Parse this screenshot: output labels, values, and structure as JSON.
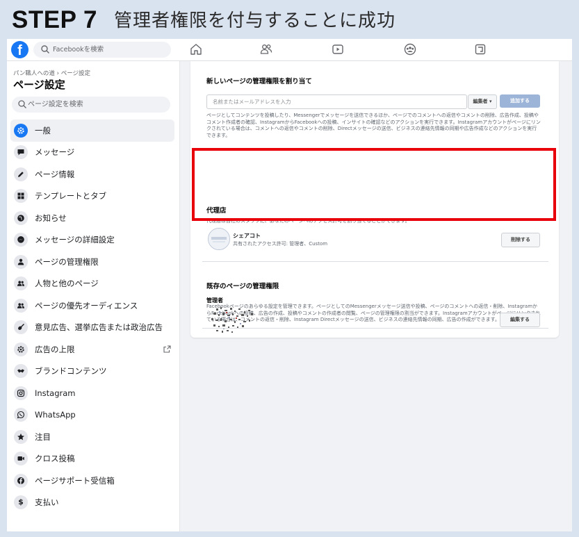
{
  "heading": {
    "step": "STEP 7",
    "description": "管理者権限を付与することに成功"
  },
  "topbar": {
    "logo_letter": "f",
    "search_placeholder": "Facebookを検索",
    "nav_icons": [
      "home-icon",
      "friends-icon",
      "watch-icon",
      "groups-icon",
      "gaming-icon"
    ]
  },
  "sidebar": {
    "breadcrumb": "パン職人への道 › ページ設定",
    "title": "ページ設定",
    "search_placeholder": "ページ設定を検索",
    "items": [
      {
        "label": "一般",
        "icon": "gear-icon"
      },
      {
        "label": "メッセージ",
        "icon": "message-icon"
      },
      {
        "label": "ページ情報",
        "icon": "pencil-icon"
      },
      {
        "label": "テンプレートとタブ",
        "icon": "grid-icon"
      },
      {
        "label": "お知らせ",
        "icon": "globe-icon"
      },
      {
        "label": "メッセージの詳細設定",
        "icon": "messenger-icon"
      },
      {
        "label": "ページの管理権限",
        "icon": "person-icon"
      },
      {
        "label": "人物と他のページ",
        "icon": "people-icon"
      },
      {
        "label": "ページの優先オーディエンス",
        "icon": "people-icon"
      },
      {
        "label": "意見広告、選挙広告または政治広告",
        "icon": "guitar-icon"
      },
      {
        "label": "広告の上限",
        "icon": "gear-icon"
      },
      {
        "label": "ブランドコンテンツ",
        "icon": "handshake-icon"
      },
      {
        "label": "Instagram",
        "icon": "instagram-icon"
      },
      {
        "label": "WhatsApp",
        "icon": "whatsapp-icon"
      },
      {
        "label": "注目",
        "icon": "star-icon"
      },
      {
        "label": "クロス投稿",
        "icon": "video-icon"
      },
      {
        "label": "ページサポート受信箱",
        "icon": "facebook-icon"
      },
      {
        "label": "支払い",
        "icon": "dollar-icon"
      }
    ]
  },
  "assign": {
    "title": "新しいページの管理権限を割り当て",
    "input_placeholder": "名前またはメールアドレスを入力",
    "role_select": "編集者 ▾",
    "add_button": "追加する",
    "description": "ページとしてコンテンツを投稿したり、Messengerでメッセージを送信できるほか、ページでのコメントへの返信やコメントの削除、広告作成、投稿やコメント作成者の確認、InstagramからFacebookへの投稿、インサイトの確認などのアクションを実行できます。Instagramアカウントがページにリンクされている場合は、コメントへの返信やコメントの削除、Directメッセージの送信、ビジネスの連絡先情報の同期や広告作成などのアクションを実行できます。"
  },
  "agency": {
    "title": "代理店",
    "description": "代理店は自社のスタッフに、あなたのページへのアクセス許可を割り当てることができます。",
    "name": "シェアコト",
    "permission": "共有されたアクセス許可: 管理者、Custom",
    "delete_button": "削除する"
  },
  "existing": {
    "title": "既存のページの管理権限",
    "role": "管理者",
    "description": "Facebookページのあらゆる設定を管理できます。ページとしてのMessengerメッセージ送信や投稿、ページのコメントへの返信・削除、InstagramからFacebookへの投稿、広告の作成、投稿やコメントの作成者の閲覧、ページの管理権限の割当ができます。Instagramアカウントがページにリンクされている場合は、コメントの返信・削除、Instagram Directメッセージの送信、ビジネスの連絡先情報の同期、広告の作成ができます。",
    "edit_button": "編集する"
  },
  "colors": {
    "highlight": "#e8000b",
    "brand": "#1877f2",
    "add_button": "#9cb4d8"
  }
}
